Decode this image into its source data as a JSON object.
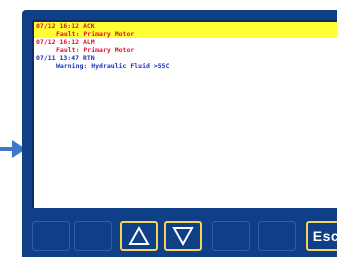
{
  "alarms": [
    {
      "date": "07/12",
      "time": "16:12",
      "state": "ACK",
      "detail": "Fault: Primary Motor",
      "selected": true
    },
    {
      "date": "07/12",
      "time": "16:12",
      "state": "ALM",
      "detail": "Fault: Primary Motor",
      "selected": false
    },
    {
      "date": "07/11",
      "time": "13:47",
      "state": "RTN",
      "detail": "Warning: Hydraulic Fluid >55C",
      "selected": false
    }
  ],
  "alarm_heads": [
    "07/12 16:12 ACK",
    "07/12 16:12 ALM",
    "07/11 13:47 RTN"
  ],
  "softkeys": {
    "up_icon": "up-triangle-icon",
    "down_icon": "down-triangle-icon",
    "esc_label": "Esc"
  },
  "colors": {
    "bezel": "#0f3f86",
    "selected_row": "#ffff33",
    "alarm_text": "#e0112e",
    "rtn_text": "#1b2fbf",
    "active_key_border": "#f7d25a"
  }
}
